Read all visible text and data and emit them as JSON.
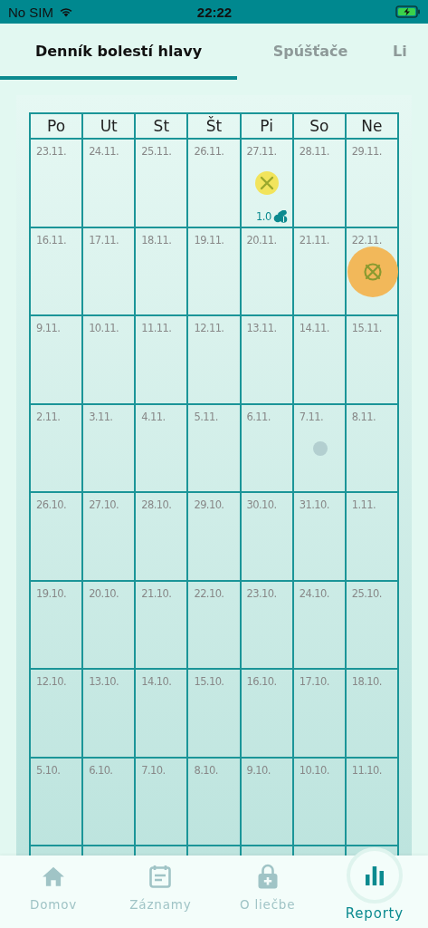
{
  "status_bar": {
    "carrier": "No SIM",
    "time": "22:22"
  },
  "tabs": [
    {
      "label": "Denník bolestí hlavy",
      "selected": true
    },
    {
      "label": "Spúšťače",
      "selected": false
    },
    {
      "label": "Li",
      "selected": false
    }
  ],
  "calendar": {
    "weekdays": [
      "Po",
      "Ut",
      "St",
      "Št",
      "Pi",
      "So",
      "Ne"
    ],
    "weeks": [
      {
        "days": [
          {
            "date": "23.11."
          },
          {
            "date": "24.11."
          },
          {
            "date": "25.11."
          },
          {
            "date": "26.11."
          },
          {
            "date": "27.11.",
            "marker": {
              "kind": "mild",
              "color": "#f2e45c"
            },
            "medication": "1.0"
          },
          {
            "date": "28.11."
          },
          {
            "date": "29.11."
          }
        ]
      },
      {
        "days": [
          {
            "date": "16.11."
          },
          {
            "date": "17.11."
          },
          {
            "date": "18.11."
          },
          {
            "date": "19.11."
          },
          {
            "date": "20.11."
          },
          {
            "date": "21.11."
          },
          {
            "date": "22.11.",
            "marker": {
              "kind": "severe",
              "color": "#f2b85a"
            }
          }
        ]
      },
      {
        "days": [
          {
            "date": "9.11."
          },
          {
            "date": "10.11."
          },
          {
            "date": "11.11."
          },
          {
            "date": "12.11."
          },
          {
            "date": "13.11."
          },
          {
            "date": "14.11."
          },
          {
            "date": "15.11."
          }
        ]
      },
      {
        "days": [
          {
            "date": "2.11."
          },
          {
            "date": "3.11."
          },
          {
            "date": "4.11."
          },
          {
            "date": "5.11."
          },
          {
            "date": "6.11."
          },
          {
            "date": "7.11.",
            "marker": {
              "kind": "dot",
              "color": "#b3cfd0"
            }
          },
          {
            "date": "8.11."
          }
        ]
      },
      {
        "days": [
          {
            "date": "26.10."
          },
          {
            "date": "27.10."
          },
          {
            "date": "28.10."
          },
          {
            "date": "29.10."
          },
          {
            "date": "30.10."
          },
          {
            "date": "31.10."
          },
          {
            "date": "1.11."
          }
        ]
      },
      {
        "days": [
          {
            "date": "19.10."
          },
          {
            "date": "20.10."
          },
          {
            "date": "21.10."
          },
          {
            "date": "22.10."
          },
          {
            "date": "23.10."
          },
          {
            "date": "24.10."
          },
          {
            "date": "25.10."
          }
        ]
      },
      {
        "days": [
          {
            "date": "12.10."
          },
          {
            "date": "13.10."
          },
          {
            "date": "14.10."
          },
          {
            "date": "15.10."
          },
          {
            "date": "16.10."
          },
          {
            "date": "17.10."
          },
          {
            "date": "18.10."
          }
        ]
      },
      {
        "days": [
          {
            "date": "5.10."
          },
          {
            "date": "6.10."
          },
          {
            "date": "7.10."
          },
          {
            "date": "8.10."
          },
          {
            "date": "9.10."
          },
          {
            "date": "10.10."
          },
          {
            "date": "11.10."
          }
        ]
      }
    ]
  },
  "nav": [
    {
      "label": "Domov",
      "kind": "home",
      "selected": false
    },
    {
      "label": "Záznamy",
      "kind": "notes",
      "selected": false
    },
    {
      "label": "O liečbe",
      "kind": "lock",
      "selected": false
    },
    {
      "label": "Reporty",
      "kind": "chart",
      "selected": true
    }
  ]
}
